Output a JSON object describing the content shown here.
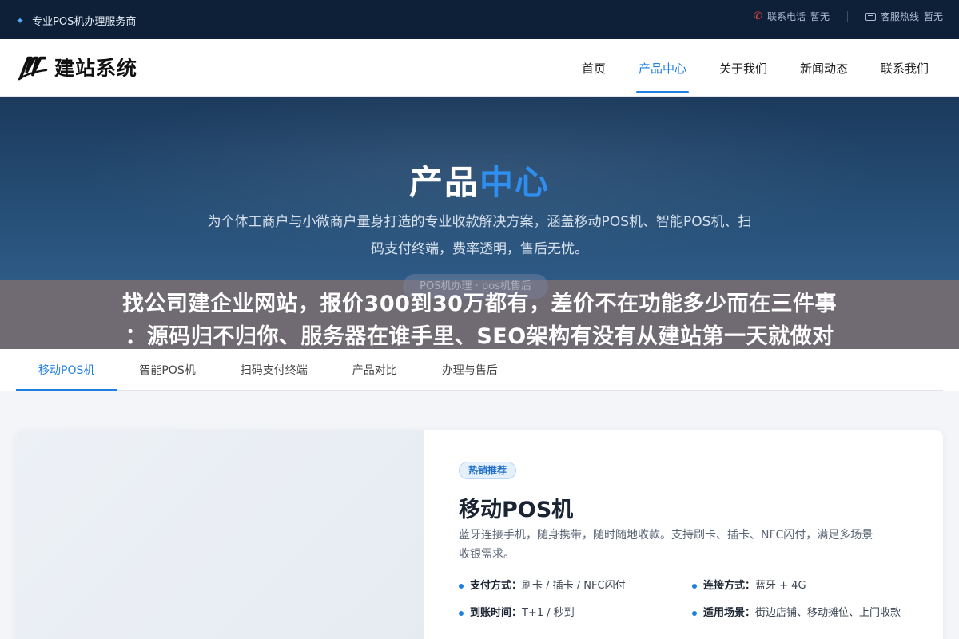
{
  "topbar": {
    "site_label": "专业POS机办理服务商",
    "hotline_label": "联系电话",
    "hotline_value": "暂无",
    "wechat_label": "客服热线",
    "wechat_value": "暂无"
  },
  "header": {
    "logo_text": "建站系统",
    "nav": [
      {
        "label": "首页",
        "active": false
      },
      {
        "label": "产品中心",
        "active": true
      },
      {
        "label": "关于我们",
        "active": false
      },
      {
        "label": "新闻动态",
        "active": false
      },
      {
        "label": "联系我们",
        "active": false
      }
    ]
  },
  "hero": {
    "title_main": "产品",
    "title_accent": "中心",
    "description_line1": "为个体工商户与小微商户量身打造的专业收款解决方案，涵盖移动POS机、智能POS机、扫",
    "description_line2": "码支付终端，费率透明，售后无忧。",
    "breadcrumb": "POS机办理 · pos机售后"
  },
  "overlay": {
    "line1": "找公司建企业网站，报价300到30万都有，差价不在功能多少而在三件事",
    "line2": "：源码归不归你、服务器在谁手里、SEO架构有没有从建站第一天就做对"
  },
  "tabs": [
    {
      "label": "移动POS机",
      "active": true
    },
    {
      "label": "智能POS机",
      "active": false
    },
    {
      "label": "扫码支付终端",
      "active": false
    },
    {
      "label": "产品对比",
      "active": false
    },
    {
      "label": "办理与售后",
      "active": false
    }
  ],
  "product": {
    "badge": "热销推荐",
    "title": "移动POS机",
    "desc_line1": "蓝牙连接手机，随身携带，随时随地收款。支持刷卡、插卡、NFC闪付，满足多场景",
    "desc_line2": "收银需求。",
    "specs": [
      {
        "key": "支付方式：",
        "value": "刷卡 / 插卡 / NFC闪付"
      },
      {
        "key": "连接方式：",
        "value": "蓝牙 + 4G"
      },
      {
        "key": "到账时间：",
        "value": "T+1 / 秒到"
      },
      {
        "key": "适用场景：",
        "value": "街边店铺、移动摊位、上门收款"
      }
    ]
  },
  "colors": {
    "accent": "#1e7fe0",
    "topbar_bg": "#0e2038",
    "hero_bg": "#264e76"
  }
}
